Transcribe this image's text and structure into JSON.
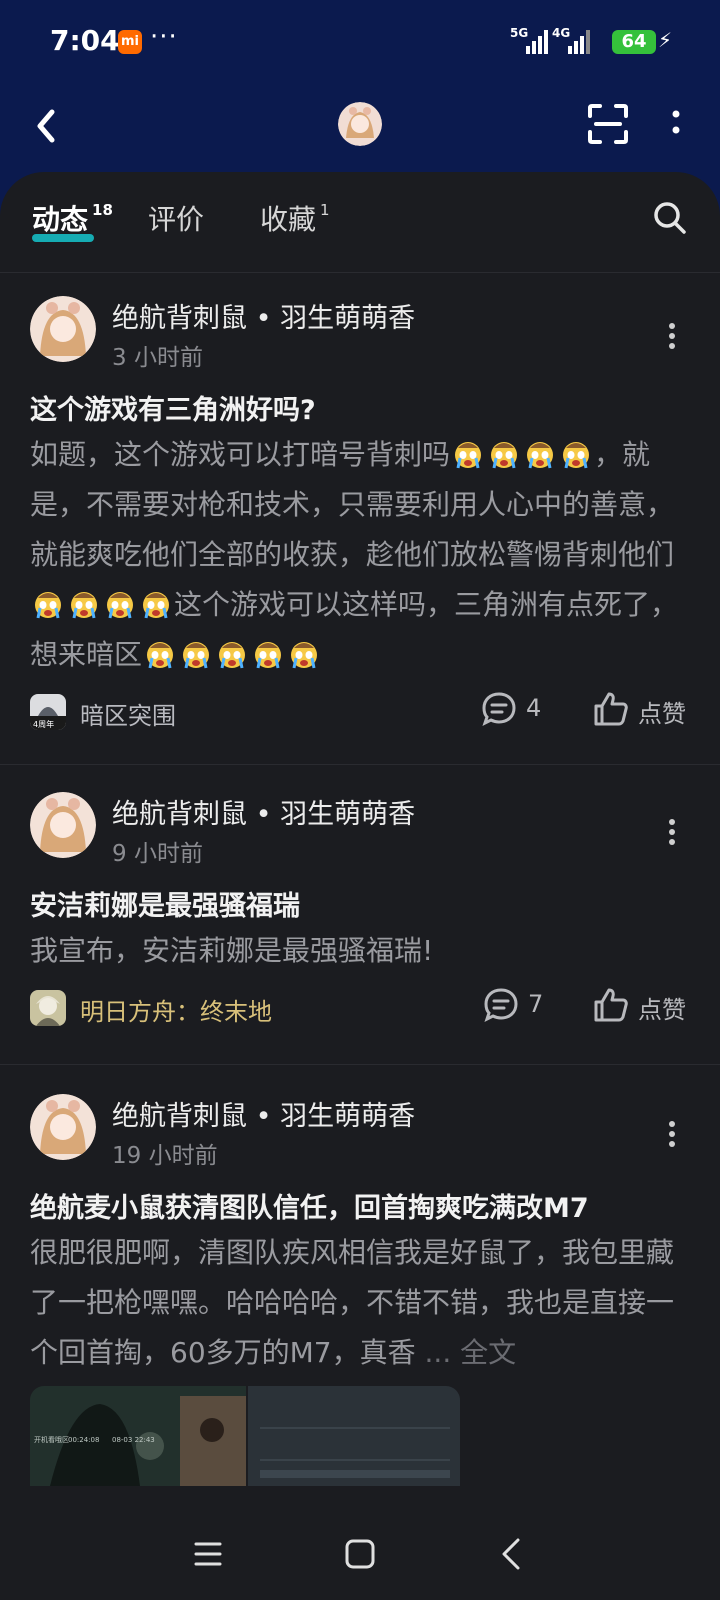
{
  "status_bar": {
    "time": "7:04",
    "mi_label": "mi",
    "dots": "···",
    "net1": "5G",
    "net2": "4G",
    "battery": "64"
  },
  "tabs": [
    {
      "label": "动态",
      "count": "18"
    },
    {
      "label": "评价",
      "count": ""
    },
    {
      "label": "收藏",
      "count": "1"
    }
  ],
  "posts": [
    {
      "author": "绝航背刺鼠 • 羽生萌萌香",
      "time": "3 小时前",
      "title": "这个游戏有三角洲好吗?",
      "body_seg1": "如题，这个游戏可以打暗号背刺吗",
      "body_seg2": "，就是，不需要对枪和技术，只需要利用人心中的善意，就能爽吃他们全部的收获，趁他们放松警惕背刺他们",
      "body_seg3": "这个游戏可以这样吗，三角洲有点死了，想来暗区",
      "game": "暗区突围",
      "game_icon_text": "4周年",
      "comments": "4",
      "like_label": "点赞"
    },
    {
      "author": "绝航背刺鼠 • 羽生萌萌香",
      "time": "9 小时前",
      "title": "安洁莉娜是最强骚福瑞",
      "body": "我宣布，安洁莉娜是最强骚福瑞!",
      "game": "明日方舟：终末地",
      "comments": "7",
      "like_label": "点赞"
    },
    {
      "author": "绝航背刺鼠 • 羽生萌萌香",
      "time": "19 小时前",
      "title": "绝航麦小鼠获清图队信任，回首掏爽吃满改M7",
      "body": "很肥很肥啊，清图队疾风相信我是好鼠了，我包里藏了一把枪嘿嘿。哈哈哈哈，不错不错，我也是直接一个回首掏，60多万的M7，真香",
      "more": "... 全文",
      "thumb_text_1": "开机看哦区",
      "thumb_text_2": "00:24:08",
      "thumb_text_3": "08-03 22:43"
    }
  ],
  "colors": {
    "header_bg": "#0b1a4e",
    "panel_bg": "#1b1c20",
    "accent": "#15c5ce",
    "game1_tag": "#b9bac0",
    "game2_tag": "#d8c07a"
  },
  "icons": [
    "back-arrow-icon",
    "scan-icon",
    "more-vertical-icon",
    "search-icon",
    "comment-icon",
    "thumbs-up-icon",
    "menu-icon",
    "home-square-icon",
    "back-triangle-icon",
    "crying-emoji-icon"
  ]
}
